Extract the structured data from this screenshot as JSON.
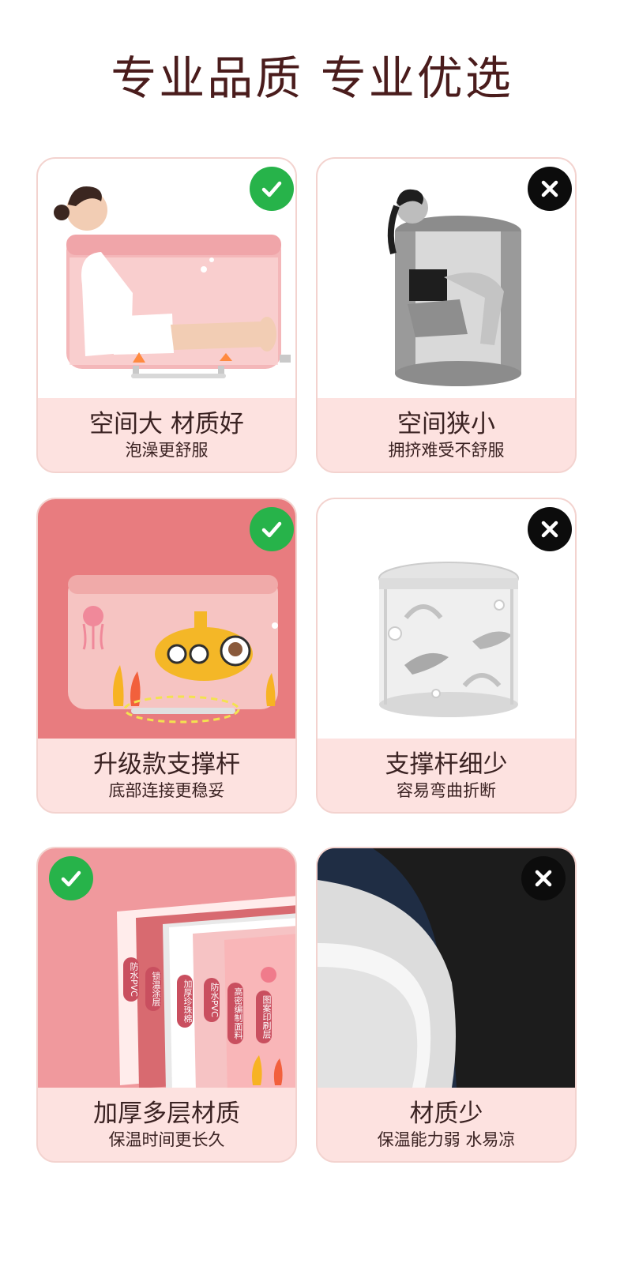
{
  "header": {
    "title": "专业品质  专业优选"
  },
  "cards": [
    {
      "title": "空间大 材质好",
      "subtitle": "泡澡更舒服",
      "verdict": "good"
    },
    {
      "title": "空间狭小",
      "subtitle": "拥挤难受不舒服",
      "verdict": "bad"
    },
    {
      "title": "升级款支撑杆",
      "subtitle": "底部连接更稳妥",
      "verdict": "good"
    },
    {
      "title": "支撑杆细少",
      "subtitle": "容易弯曲折断",
      "verdict": "bad"
    },
    {
      "title": "加厚多层材质",
      "subtitle": "保温时间更长久",
      "verdict": "good"
    },
    {
      "title": "材质少",
      "subtitle": "保温能力弱 水易凉",
      "verdict": "bad"
    }
  ],
  "layers": [
    "防水PVC",
    "锁温涂层",
    "加厚珍珠棉",
    "防水PVC",
    "高密编制面料",
    "图案印刷层"
  ],
  "icons": {
    "good": "check-icon",
    "bad": "cross-icon"
  },
  "colors": {
    "good": "#27b34a",
    "bad": "#0c0c0c",
    "caption_bg": "#fde2e0",
    "title": "#4a1c1c"
  }
}
